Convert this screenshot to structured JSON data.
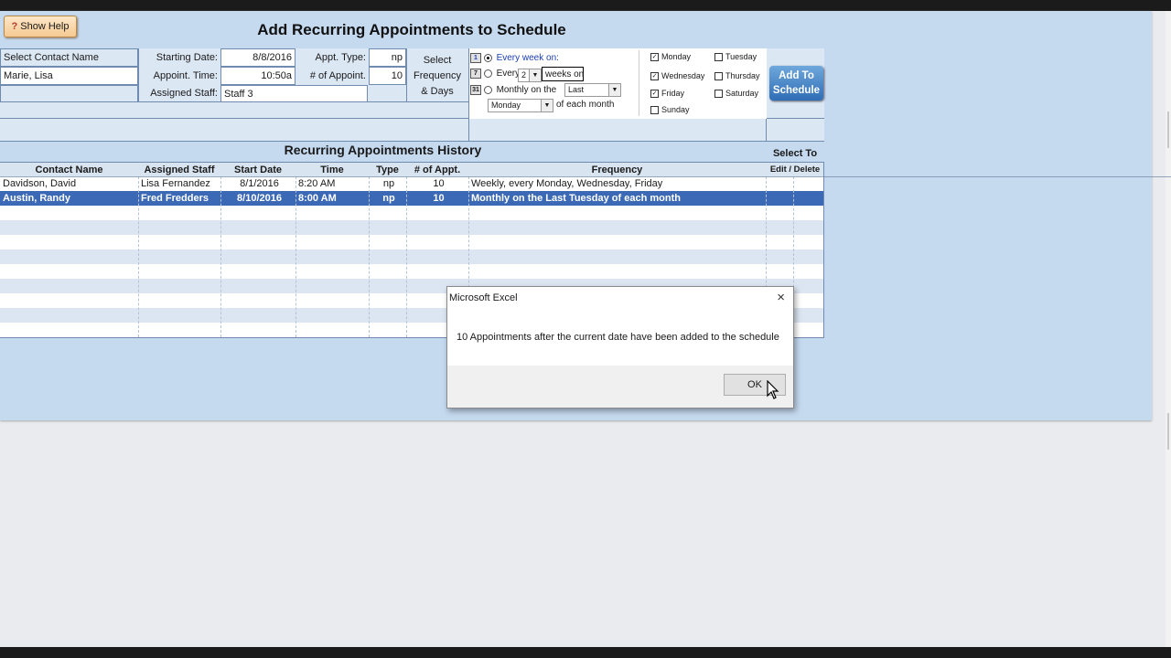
{
  "toolbar": {
    "show_help_label": "Show Help"
  },
  "page_title": "Add Recurring Appointments to Schedule",
  "form": {
    "select_contact_label": "Select Contact Name",
    "contact_value": "Marie, Lisa",
    "starting_date_label": "Starting Date:",
    "starting_date_value": "8/8/2016",
    "appt_time_label": "Appoint. Time:",
    "appt_time_value": "10:50a",
    "assigned_staff_label": "Assigned Staff:",
    "assigned_staff_value": "Staff 3",
    "appt_type_label": "Appt. Type:",
    "appt_type_value": "np",
    "num_appoint_label": "# of Appoint.",
    "num_appoint_value": "10",
    "select_freq_line1": "Select",
    "select_freq_line2": "Frequency",
    "select_freq_line3": "& Days"
  },
  "frequency": {
    "option_weekly": "Every week on:",
    "option_every": "Every",
    "every_value": "2",
    "weeks_on_label": "weeks on",
    "option_monthly": "Monthly on the",
    "monthly_ordinal": "Last",
    "monthly_day": "Monday",
    "of_each_month": "of each month",
    "cal_icon_1": "1",
    "cal_icon_7": "7",
    "cal_icon_31": "31"
  },
  "days": {
    "monday": "Monday",
    "tuesday": "Tuesday",
    "wednesday": "Wednesday",
    "thursday": "Thursday",
    "friday": "Friday",
    "saturday": "Saturday",
    "sunday": "Sunday"
  },
  "add_button": {
    "line1": "Add To",
    "line2": "Schedule"
  },
  "history": {
    "title": "Recurring Appointments History",
    "select_to": "Select To",
    "edit_delete": "Edit / Delete",
    "columns": [
      "Contact Name",
      "Assigned Staff",
      "Start Date",
      "Time",
      "Type",
      "# of Appt.",
      "Frequency"
    ],
    "rows": [
      [
        "Davidson, David",
        "Lisa Fernandez",
        "8/1/2016",
        "8:20 AM",
        "np",
        "10",
        "Weekly, every Monday, Wednesday, Friday"
      ],
      [
        "Austin, Randy",
        "Fred Fredders",
        "8/10/2016",
        "8:00 AM",
        "np",
        "10",
        "Monthly on the Last Tuesday of each month"
      ]
    ]
  },
  "dialog": {
    "title": "Microsoft Excel",
    "message": "10 Appointments after the current date have been added to the schedule",
    "ok_label": "OK",
    "close_glyph": "×"
  },
  "colors": {
    "accent": "#3b69b5",
    "sheet_bg": "#c5d9ef",
    "button_blue": "#2f6db5"
  }
}
